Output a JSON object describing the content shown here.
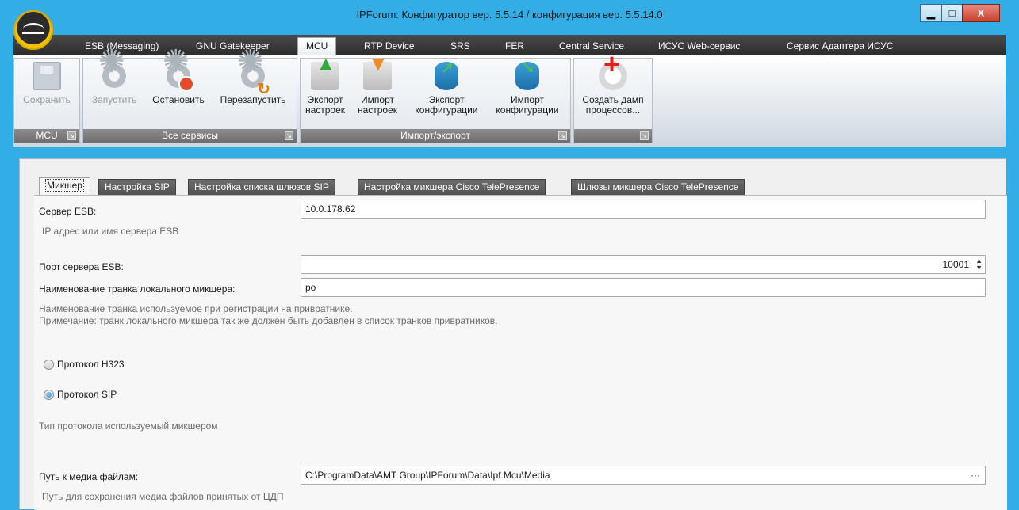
{
  "window": {
    "title": "IPForum: Конфигуратор вер. 5.5.14 / конфигурация вер. 5.5.14.0",
    "minimize": "▁",
    "maximize": "□",
    "close": "X"
  },
  "ribbon_tabs": [
    {
      "label": "ESB (Messaging)"
    },
    {
      "label": "GNU Gatekeeper"
    },
    {
      "label": "MCU"
    },
    {
      "label": "RTP Device"
    },
    {
      "label": "SRS"
    },
    {
      "label": "FER"
    },
    {
      "label": "Central Service"
    },
    {
      "label": "ИСУС Web-сервис"
    },
    {
      "label": "Сервис Адаптера ИСУС"
    }
  ],
  "active_ribbon_tab": "MCU",
  "ribbon_groups": [
    {
      "label": "MCU",
      "buttons": [
        {
          "label": "Сохранить",
          "icon": "save-icon",
          "disabled": true
        }
      ]
    },
    {
      "label": "Все сервисы",
      "buttons": [
        {
          "label": "Запустить",
          "icon": "gear-start-icon",
          "disabled": true
        },
        {
          "label": "Остановить",
          "icon": "gear-stop-icon"
        },
        {
          "label": "Перезапустить",
          "icon": "gear-restart-icon"
        }
      ]
    },
    {
      "label": "Импорт/экспорт",
      "buttons": [
        {
          "label1": "Экспорт",
          "label2": "настроек",
          "icon": "export-settings-icon"
        },
        {
          "label1": "Импорт",
          "label2": "настроек",
          "icon": "import-settings-icon"
        },
        {
          "label1": "Экспорт",
          "label2": "конфигурации",
          "icon": "export-config-icon"
        },
        {
          "label1": "Импорт",
          "label2": "конфигурации",
          "icon": "import-config-icon"
        }
      ]
    },
    {
      "label": "",
      "buttons": [
        {
          "label1": "Создать дамп",
          "label2": "процессов...",
          "icon": "process-dump-icon"
        }
      ]
    }
  ],
  "sub_tabs": [
    {
      "label": "Микшер"
    },
    {
      "label": "Настройка SIP"
    },
    {
      "label": "Настройка списка шлюзов SIP"
    },
    {
      "label": "Настройка микшера Cisco TelePresence"
    },
    {
      "label": "Шлюзы микшера Cisco TelePresence"
    }
  ],
  "form": {
    "esb_server_label": "Сервер ESB:",
    "esb_server_value": "10.0.178.62",
    "esb_server_hint": "IP адрес или имя сервера ESB",
    "esb_port_label": "Порт сервера ESB:",
    "esb_port_value": "10001",
    "trunk_label": "Наименование транка локального микшера:",
    "trunk_value": "po",
    "trunk_hint_1": "Наименование транка используемое при регистрации на привратнике.",
    "trunk_hint_2": "Примечание: транк локального микшера так же должен быть добавлен в список транков привратников.",
    "protocol_h323": "Протокол H323",
    "protocol_sip": "Протокол SIP",
    "protocol_selected": "SIP",
    "protocol_hint": "Тип протокола используемый микшером",
    "media_path_label": "Путь к медиа файлам:",
    "media_path_value": "C:\\ProgramData\\AMT Group\\IPForum\\Data\\Ipf.Mcu\\Media",
    "media_path_browse": "···",
    "media_path_hint": "Путь для сохранения медиа файлов принятых от ЦДП"
  }
}
